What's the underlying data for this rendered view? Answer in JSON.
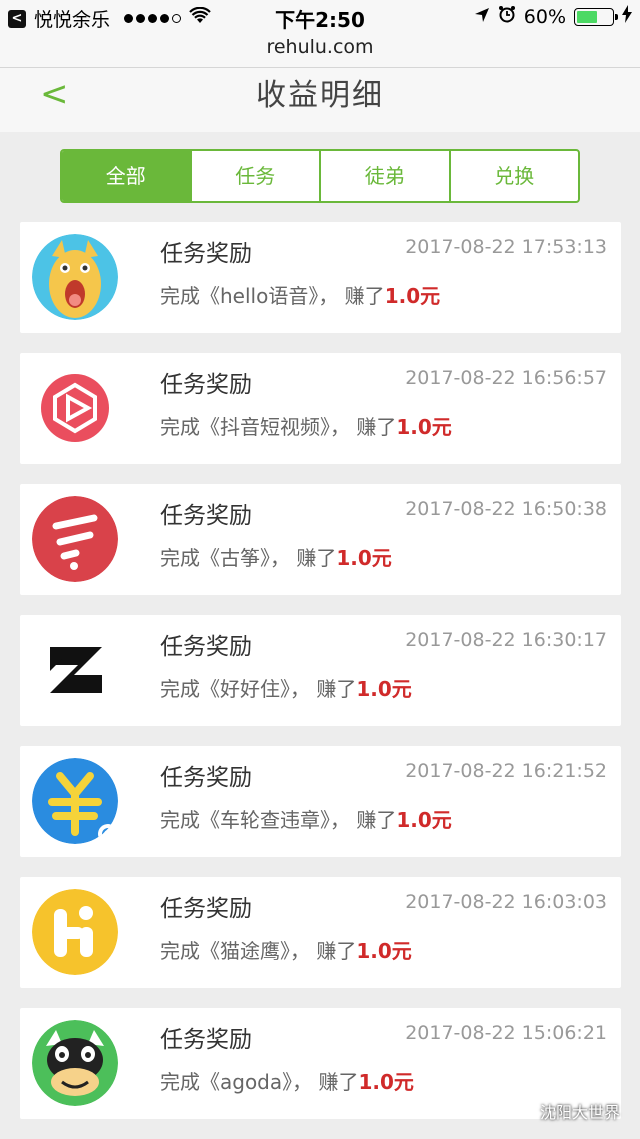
{
  "status_bar": {
    "carrier": "悦悦余乐",
    "time": "下午2:50",
    "battery": "60%",
    "battery_level": 0.6
  },
  "url": "rehulu.com",
  "header": {
    "back_label": "<",
    "title": "收益明细"
  },
  "tabs": [
    {
      "label": "全部",
      "active": true
    },
    {
      "label": "任务",
      "active": false
    },
    {
      "label": "徒弟",
      "active": false
    },
    {
      "label": "兑换",
      "active": false
    }
  ],
  "records": [
    {
      "title": "任务奖励",
      "time": "2017-08-22 17:53:13",
      "prefix": "完成《hello语音》，  赚了",
      "amount": "1.0元",
      "icon": "llama-icon"
    },
    {
      "title": "任务奖励",
      "time": "2017-08-22 16:56:57",
      "prefix": "完成《抖音短视频》，  赚了",
      "amount": "1.0元",
      "icon": "douyin-icon"
    },
    {
      "title": "任务奖励",
      "time": "2017-08-22 16:50:38",
      "prefix": "完成《古筝》，  赚了",
      "amount": "1.0元",
      "icon": "guzheng-icon"
    },
    {
      "title": "任务奖励",
      "time": "2017-08-22 16:30:17",
      "prefix": "完成《好好住》，  赚了",
      "amount": "1.0元",
      "icon": "haohaozhu-icon"
    },
    {
      "title": "任务奖励",
      "time": "2017-08-22 16:21:52",
      "prefix": "完成《车轮查违章》，  赚了",
      "amount": "1.0元",
      "icon": "yuan-icon"
    },
    {
      "title": "任务奖励",
      "time": "2017-08-22 16:03:03",
      "prefix": "完成《猫途鹰》，  赚了",
      "amount": "1.0元",
      "icon": "hi-icon"
    },
    {
      "title": "任务奖励",
      "time": "2017-08-22 15:06:21",
      "prefix": "完成《agoda》，  赚了",
      "amount": "1.0元",
      "icon": "cow-icon"
    }
  ],
  "watermark": "沈阳大世界",
  "colors": {
    "accent": "#6ab83a",
    "amount": "#d02a2a"
  }
}
